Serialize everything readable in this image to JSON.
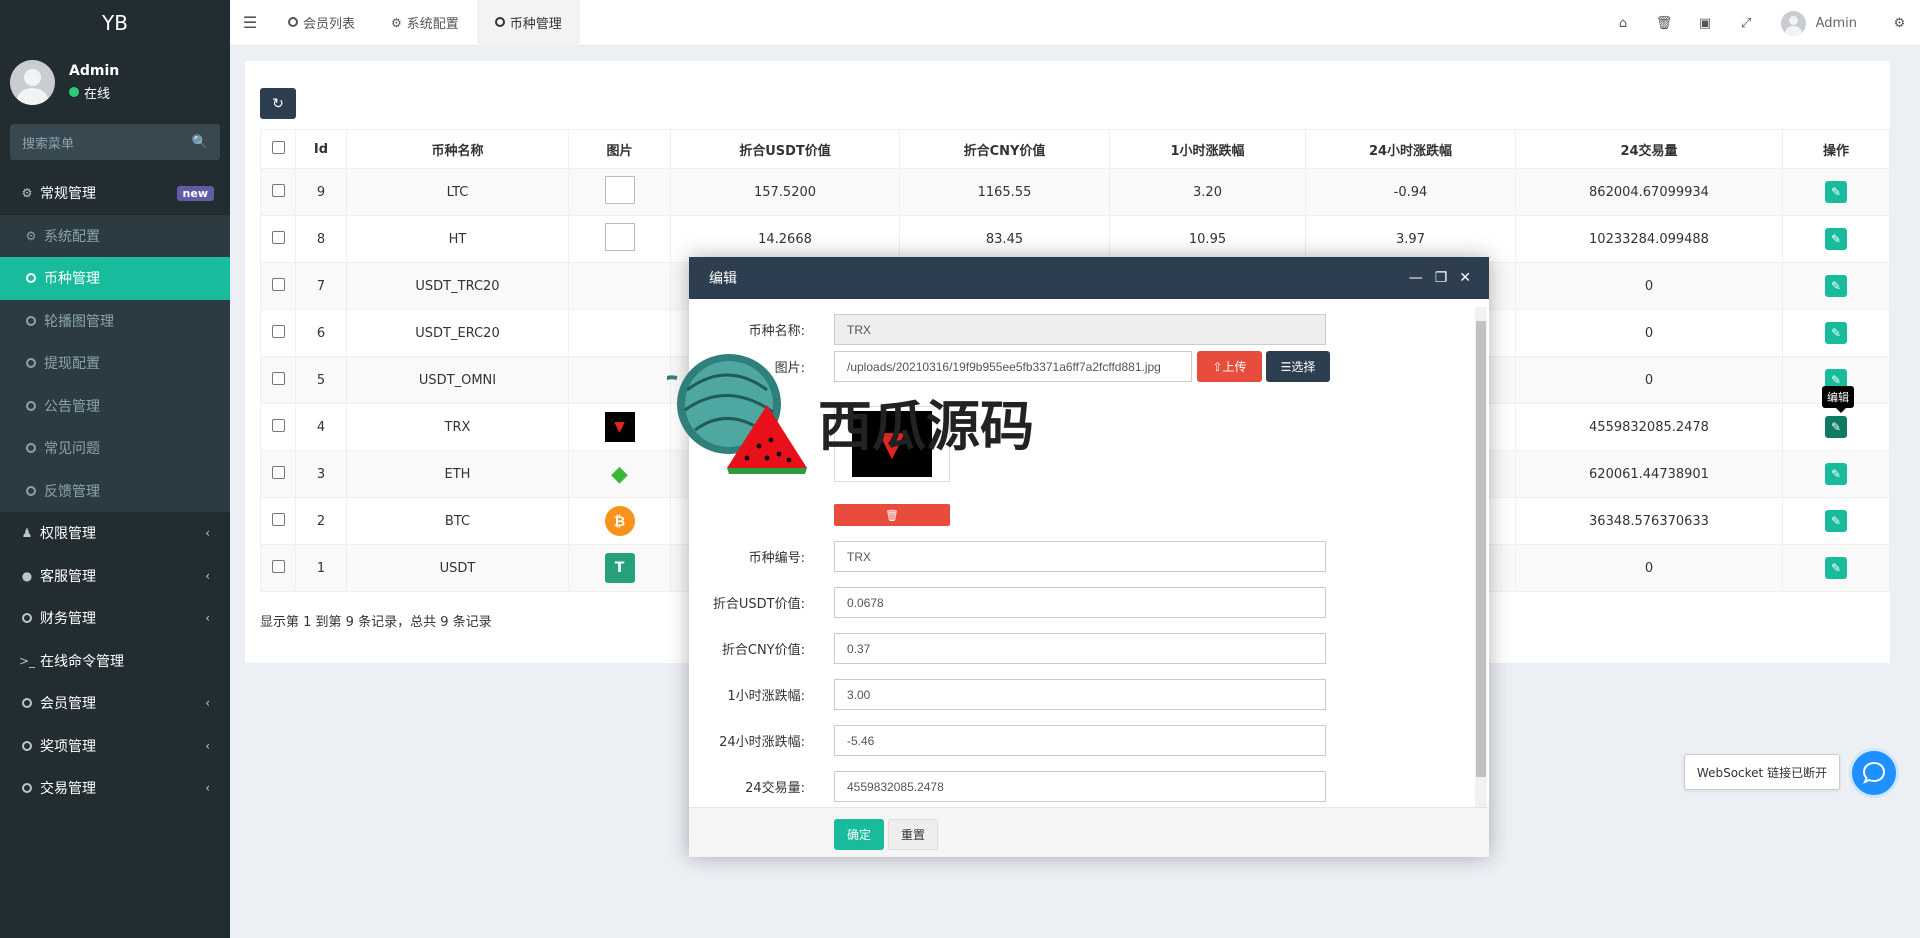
{
  "sidebar": {
    "logo": "YB",
    "user": {
      "name": "Admin",
      "status": "在线"
    },
    "search_placeholder": "搜索菜单",
    "items": [
      {
        "label": "常规管理",
        "badge": "new"
      },
      {
        "label": "系统配置"
      },
      {
        "label": "币种管理"
      },
      {
        "label": "轮播图管理"
      },
      {
        "label": "提现配置"
      },
      {
        "label": "公告管理"
      },
      {
        "label": "常见问题"
      },
      {
        "label": "反馈管理"
      },
      {
        "label": "权限管理"
      },
      {
        "label": "客服管理"
      },
      {
        "label": "财务管理"
      },
      {
        "label": "在线命令管理"
      },
      {
        "label": "会员管理"
      },
      {
        "label": "奖项管理"
      },
      {
        "label": "交易管理"
      }
    ]
  },
  "topnav": {
    "tabs": [
      "会员列表",
      "系统配置",
      "币种管理"
    ],
    "user": "Admin"
  },
  "table": {
    "headers": [
      "Id",
      "币种名称",
      "图片",
      "折合USDT价值",
      "折合CNY价值",
      "1小时涨跌幅",
      "24小时涨跌幅",
      "24交易量",
      "操作"
    ],
    "rows": [
      {
        "id": "9",
        "name": "LTC",
        "usdt": "157.5200",
        "cny": "1165.55",
        "h1": "3.20",
        "h24": "-0.94",
        "vol": "862004.67099934"
      },
      {
        "id": "8",
        "name": "HT",
        "usdt": "14.2668",
        "cny": "83.45",
        "h1": "10.95",
        "h24": "3.97",
        "vol": "10233284.099488"
      },
      {
        "id": "7",
        "name": "USDT_TRC20",
        "usdt": "",
        "cny": "",
        "h1": "",
        "h24": "",
        "vol": "0"
      },
      {
        "id": "6",
        "name": "USDT_ERC20",
        "usdt": "",
        "cny": "",
        "h1": "",
        "h24": "",
        "vol": "0"
      },
      {
        "id": "5",
        "name": "USDT_OMNI",
        "usdt": "",
        "cny": "",
        "h1": "",
        "h24": "",
        "vol": "0"
      },
      {
        "id": "4",
        "name": "TRX",
        "usdt": "",
        "cny": "",
        "h1": "",
        "h24": "",
        "vol": "4559832085.2478"
      },
      {
        "id": "3",
        "name": "ETH",
        "usdt": "",
        "cny": "",
        "h1": "",
        "h24": "",
        "vol": "620061.44738901"
      },
      {
        "id": "2",
        "name": "BTC",
        "usdt": "",
        "cny": "",
        "h1": "",
        "h24": "",
        "vol": "36348.576370633"
      },
      {
        "id": "1",
        "name": "USDT",
        "usdt": "",
        "cny": "",
        "h1": "",
        "h24": "",
        "vol": "0"
      }
    ],
    "footer": "显示第 1 到第 9 条记录，总共 9 条记录",
    "tooltip": "编辑"
  },
  "modal": {
    "title": "编辑",
    "fields": {
      "name_label": "币种名称:",
      "name_value": "TRX",
      "image_label": "图片:",
      "image_value": "/uploads/20210316/19f9b955ee5fb3371a6ff7a2fcffd881.jpg",
      "upload_label": "上传",
      "select_label": "选择",
      "code_label": "币种编号:",
      "code_value": "TRX",
      "usdt_label": "折合USDT价值:",
      "usdt_value": "0.0678",
      "cny_label": "折合CNY价值:",
      "cny_value": "0.37",
      "h1_label": "1小时涨跌幅:",
      "h1_value": "3.00",
      "h24_label": "24小时涨跌幅:",
      "h24_value": "-5.46",
      "vol_label": "24交易量:",
      "vol_value": "4559832085.2478"
    },
    "ok_label": "确定",
    "reset_label": "重置"
  },
  "watermark": {
    "text": "西瓜源码"
  },
  "websocket": {
    "text": "WebSocket 链接已断开"
  },
  "colors": {
    "sidebar_bg": "#222d32",
    "accent": "#18bc9c",
    "dark_header": "#2c3e50",
    "danger": "#e74c3c"
  }
}
